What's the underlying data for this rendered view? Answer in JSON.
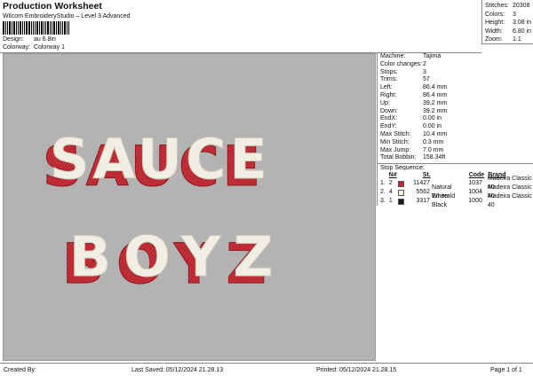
{
  "header": {
    "title": "Production Worksheet",
    "subtitle": "Wilcom EmbroideryStudio – Level 3 Advanced",
    "design_label": "Design:",
    "design_value": "au 6.8in",
    "colorway_label": "Colorway:",
    "colorway_value": "Colorway 1"
  },
  "stats": [
    {
      "label": "Stitches:",
      "value": "20308"
    },
    {
      "label": "Colors:",
      "value": "3"
    },
    {
      "label": "Height:",
      "value": "3.08 in"
    },
    {
      "label": "Width:",
      "value": "6.80 in"
    },
    {
      "label": "Zoom:",
      "value": "1:1"
    }
  ],
  "design_text": {
    "line1": "SAUCE",
    "line2": "BOYZ"
  },
  "details": [
    {
      "label": "Machine:",
      "value": "Tajima"
    },
    {
      "label": "Color changes:",
      "value": "2"
    },
    {
      "label": "Stops:",
      "value": "3"
    },
    {
      "label": "Trims:",
      "value": "57"
    },
    {
      "label": "Left:",
      "value": "86.4 mm"
    },
    {
      "label": "Right:",
      "value": "86.4 mm"
    },
    {
      "label": "Up:",
      "value": "39.2 mm"
    },
    {
      "label": "Down:",
      "value": "39.2 mm"
    },
    {
      "label": "EndX:",
      "value": "0.00 in"
    },
    {
      "label": "EndY:",
      "value": "0.00 in"
    },
    {
      "label": "Max Stitch:",
      "value": "10.4 mm"
    },
    {
      "label": "Min Stitch:",
      "value": "0.3 mm"
    },
    {
      "label": "Max Jump:",
      "value": "7.0 mm"
    },
    {
      "label": "Total Bobbin:",
      "value": "158.34ft"
    }
  ],
  "sequence": {
    "title": "Stop Sequence:",
    "headers": {
      "n": "N#",
      "st": "St.",
      "code": "Code",
      "brand": "Brand"
    },
    "rows": [
      {
        "idx": "1.",
        "n": "2",
        "color": "#c0282e",
        "st": "11427",
        "name": "",
        "code": "1037",
        "brand": "Madeira Classic 40"
      },
      {
        "idx": "2.",
        "n": "4",
        "color": "#f4f1e8",
        "st": "5562",
        "name": "Natural White",
        "code": "1004",
        "brand": "Madeira Classic 40"
      },
      {
        "idx": "3.",
        "n": "1",
        "color": "#1a1a1a",
        "st": "3317",
        "name": "Emerald Black",
        "code": "1000",
        "brand": "Madeira Classic 40"
      }
    ]
  },
  "footer": {
    "created": "Created By:",
    "saved": "Last Saved: 05/12/2024 21.28.13",
    "printed": "Printed: 05/12/2024 21.28.15",
    "page": "Page 1 of 1"
  }
}
